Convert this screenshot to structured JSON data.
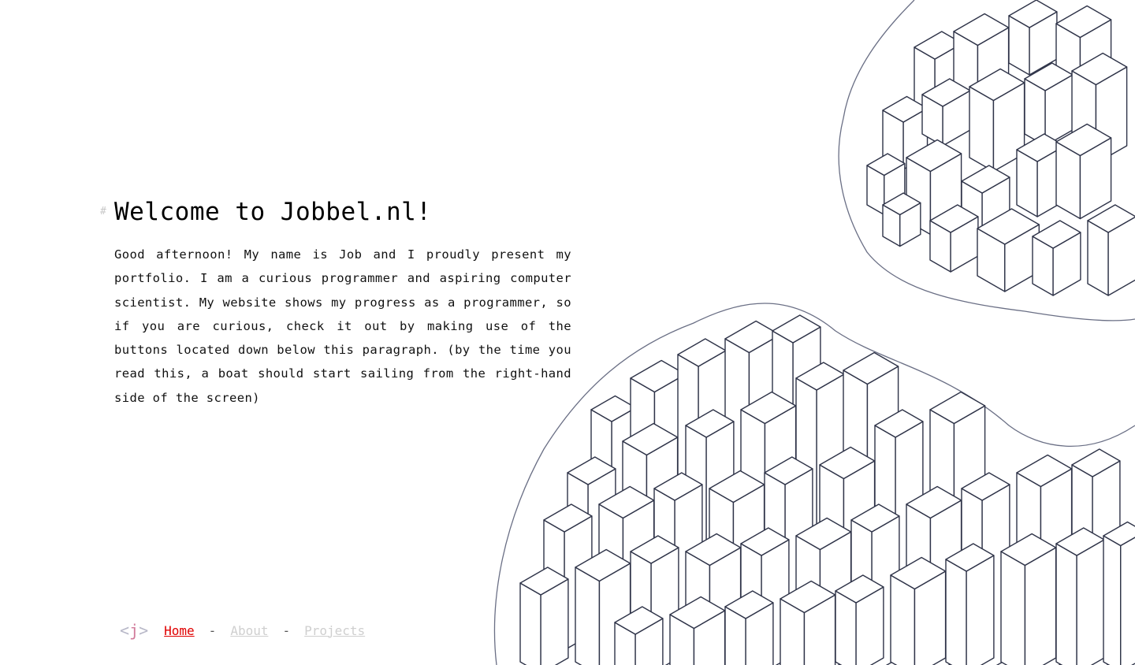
{
  "header": {
    "hash_symbol": "#",
    "title": "Welcome to Jobbel.nl!"
  },
  "intro": {
    "text": "Good afternoon! My name is Job and I proudly present my portfolio. I am a curious programmer and aspiring computer scientist. My website shows my progress as a programmer, so if you are curious, check it out by making use of the buttons located down below this paragraph. (by the time you read this, a boat should start sailing from the right-hand side of the screen)"
  },
  "nav": {
    "logo_left": "<",
    "logo_mid": "j",
    "logo_right": ">",
    "items": [
      {
        "label": "Home",
        "active": true
      },
      {
        "label": "About",
        "active": false
      },
      {
        "label": "Projects",
        "active": false
      }
    ],
    "separator": "-"
  },
  "illustration": {
    "icon": "city-sketch-illustration"
  },
  "colors": {
    "active_link": "#e00000",
    "inactive_link": "#cfcfcf",
    "sketch_stroke": "#3a3f55"
  }
}
